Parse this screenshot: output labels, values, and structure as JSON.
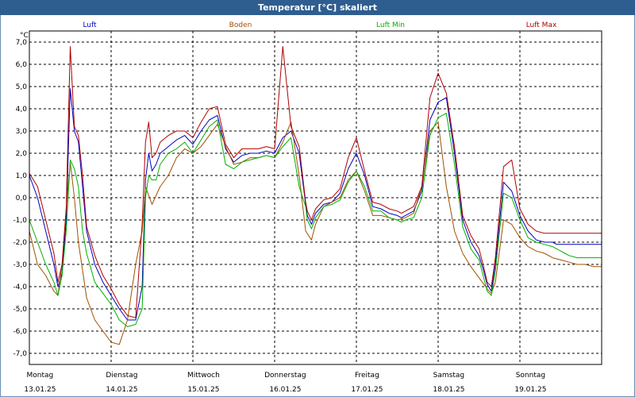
{
  "chart_data": {
    "type": "line",
    "title": "Temperatur [°C] skaliert",
    "ylabel": "°C",
    "ylim": [
      -7.5,
      7.5
    ],
    "yticks": [
      "7,0",
      "6,0",
      "5,0",
      "4,0",
      "3,0",
      "2,0",
      "1,0",
      "0,0",
      "-1,0",
      "-2,0",
      "-3,0",
      "-4,0",
      "-5,0",
      "-6,0",
      "-7,0"
    ],
    "ytick_values": [
      7,
      6,
      5,
      4,
      3,
      2,
      1,
      0,
      -1,
      -2,
      -3,
      -4,
      -5,
      -6,
      -7
    ],
    "xlim": [
      0,
      7
    ],
    "days": [
      {
        "weekday": "Montag",
        "date": "13.01.25"
      },
      {
        "weekday": "Dienstag",
        "date": "14.01.25"
      },
      {
        "weekday": "Mittwoch",
        "date": "15.01.25"
      },
      {
        "weekday": "Donnerstag",
        "date": "16.01.25"
      },
      {
        "weekday": "Freitag",
        "date": "17.01.25"
      },
      {
        "weekday": "Samstag",
        "date": "18.01.25"
      },
      {
        "weekday": "Sonntag",
        "date": "19.01.25"
      }
    ],
    "grid": true,
    "legend_position": "top",
    "series": [
      {
        "name": "Luft",
        "color": "#0000c0",
        "x": [
          0,
          0.1,
          0.2,
          0.3,
          0.35,
          0.4,
          0.45,
          0.5,
          0.55,
          0.6,
          0.65,
          0.7,
          0.8,
          0.9,
          1.0,
          1.1,
          1.2,
          1.3,
          1.38,
          1.42,
          1.46,
          1.5,
          1.55,
          1.6,
          1.7,
          1.8,
          1.9,
          2.0,
          2.1,
          2.2,
          2.3,
          2.4,
          2.5,
          2.6,
          2.7,
          2.8,
          2.9,
          3.0,
          3.1,
          3.2,
          3.3,
          3.38,
          3.4,
          3.45,
          3.5,
          3.6,
          3.7,
          3.8,
          3.9,
          4.0,
          4.1,
          4.2,
          4.3,
          4.4,
          4.5,
          4.55,
          4.6,
          4.7,
          4.8,
          4.9,
          5.0,
          5.1,
          5.2,
          5.3,
          5.4,
          5.5,
          5.55,
          5.6,
          5.65,
          5.7,
          5.8,
          5.9,
          6.0,
          6.1,
          6.2,
          6.3,
          6.4,
          6.45,
          6.5,
          6.55,
          6.6,
          6.7,
          6.8,
          6.9,
          7.0
        ],
        "y": [
          1.0,
          0,
          -1.5,
          -3.0,
          -4.0,
          -3.4,
          -1.0,
          4.9,
          3.0,
          2.5,
          0.5,
          -1.5,
          -3.0,
          -3.8,
          -4.4,
          -5.0,
          -5.5,
          -5.5,
          -4.0,
          0.8,
          2.0,
          1.2,
          1.5,
          2.0,
          2.3,
          2.6,
          2.8,
          2.4,
          3.0,
          3.5,
          3.7,
          2.2,
          1.6,
          1.9,
          2.0,
          2.0,
          2.1,
          2.0,
          2.7,
          3.0,
          2.0,
          -0.3,
          -0.8,
          -1.2,
          -0.7,
          -0.3,
          -0.2,
          0.2,
          1.3,
          2.0,
          1.0,
          -0.4,
          -0.5,
          -0.7,
          -0.8,
          -0.9,
          -0.8,
          -0.6,
          0.3,
          3.5,
          4.3,
          4.5,
          2.0,
          -1.0,
          -2.0,
          -2.6,
          -3.2,
          -3.9,
          -4.2,
          -3.0,
          0.7,
          0.3,
          -0.8,
          -1.5,
          -1.9,
          -2.0,
          -2.0,
          -2.1,
          -2.1,
          -2.1,
          -2.1,
          -2.1,
          -2.1,
          -2.1,
          -2.1
        ]
      },
      {
        "name": "Boden",
        "color": "#a05000",
        "x": [
          0,
          0.1,
          0.2,
          0.3,
          0.35,
          0.4,
          0.45,
          0.5,
          0.55,
          0.6,
          0.7,
          0.8,
          0.9,
          1.0,
          1.1,
          1.2,
          1.3,
          1.38,
          1.42,
          1.5,
          1.6,
          1.7,
          1.8,
          1.9,
          2.0,
          2.1,
          2.2,
          2.3,
          2.4,
          2.5,
          2.6,
          2.7,
          2.8,
          2.9,
          3.0,
          3.1,
          3.2,
          3.3,
          3.38,
          3.45,
          3.5,
          3.6,
          3.7,
          3.8,
          3.9,
          4.0,
          4.1,
          4.2,
          4.3,
          4.4,
          4.5,
          4.6,
          4.7,
          4.8,
          4.9,
          5.0,
          5.1,
          5.2,
          5.3,
          5.4,
          5.5,
          5.6,
          5.65,
          5.7,
          5.8,
          5.9,
          6.0,
          6.1,
          6.2,
          6.3,
          6.4,
          6.5,
          6.6,
          6.7,
          6.8,
          6.9,
          7.0
        ],
        "y": [
          -1.5,
          -3.0,
          -3.5,
          -4.2,
          -4.4,
          -3.0,
          -0.5,
          1.6,
          0,
          -2.0,
          -4.5,
          -5.5,
          -6.0,
          -6.5,
          -6.6,
          -5.5,
          -3.0,
          -1.5,
          0.5,
          -0.3,
          0.5,
          1.0,
          1.8,
          2.2,
          2.0,
          2.3,
          2.8,
          3.3,
          2.3,
          1.5,
          1.6,
          1.8,
          1.8,
          1.9,
          1.8,
          2.5,
          3.4,
          1.0,
          -1.5,
          -1.9,
          -1.2,
          -0.4,
          -0.2,
          0.0,
          0.8,
          1.2,
          0.3,
          -0.8,
          -0.8,
          -0.9,
          -1.0,
          -0.9,
          -0.7,
          0.5,
          3.0,
          3.4,
          0.5,
          -1.5,
          -2.5,
          -3.1,
          -3.6,
          -4.1,
          -4.3,
          -3.8,
          -1.0,
          -1.2,
          -1.8,
          -2.2,
          -2.4,
          -2.5,
          -2.7,
          -2.8,
          -2.9,
          -3.0,
          -3.0,
          -3.1,
          -3.1
        ]
      },
      {
        "name": "Luft Min",
        "color": "#00b000",
        "x": [
          0,
          0.1,
          0.2,
          0.3,
          0.35,
          0.4,
          0.45,
          0.5,
          0.55,
          0.6,
          0.65,
          0.7,
          0.8,
          0.9,
          1.0,
          1.1,
          1.2,
          1.3,
          1.38,
          1.42,
          1.46,
          1.5,
          1.55,
          1.6,
          1.7,
          1.8,
          1.9,
          2.0,
          2.1,
          2.2,
          2.3,
          2.4,
          2.5,
          2.6,
          2.7,
          2.8,
          2.9,
          3.0,
          3.1,
          3.2,
          3.3,
          3.38,
          3.4,
          3.45,
          3.5,
          3.6,
          3.7,
          3.8,
          3.9,
          4.0,
          4.1,
          4.2,
          4.3,
          4.4,
          4.5,
          4.55,
          4.6,
          4.7,
          4.8,
          4.9,
          5.0,
          5.1,
          5.2,
          5.3,
          5.4,
          5.5,
          5.55,
          5.6,
          5.65,
          5.7,
          5.8,
          5.9,
          6.0,
          6.1,
          6.2,
          6.3,
          6.4,
          6.45,
          6.5,
          6.55,
          6.6,
          6.7,
          6.8,
          6.9,
          7.0
        ],
        "y": [
          -1.0,
          -2.0,
          -3.0,
          -3.8,
          -4.4,
          -3.5,
          -1.5,
          1.7,
          1.3,
          0.5,
          -1.5,
          -2.5,
          -3.8,
          -4.3,
          -4.8,
          -5.5,
          -5.8,
          -5.7,
          -5.0,
          0.0,
          1.0,
          0.8,
          0.8,
          1.5,
          2.0,
          2.2,
          2.5,
          2.0,
          2.6,
          3.2,
          3.5,
          1.5,
          1.3,
          1.6,
          1.7,
          1.8,
          1.9,
          1.8,
          2.3,
          2.7,
          0.5,
          -0.4,
          -1.0,
          -1.4,
          -0.9,
          -0.4,
          -0.3,
          -0.1,
          0.7,
          1.2,
          0.5,
          -0.6,
          -0.6,
          -0.9,
          -1.0,
          -1.1,
          -1.0,
          -0.9,
          0.0,
          2.8,
          3.6,
          3.8,
          1.5,
          -1.3,
          -2.3,
          -2.8,
          -3.5,
          -4.2,
          -4.4,
          -3.3,
          0.2,
          0,
          -1.0,
          -1.8,
          -2.0,
          -2.1,
          -2.2,
          -2.3,
          -2.4,
          -2.5,
          -2.6,
          -2.7,
          -2.7,
          -2.7,
          -2.7
        ]
      },
      {
        "name": "Luft Max",
        "color": "#b00000",
        "x": [
          0,
          0.1,
          0.2,
          0.3,
          0.35,
          0.4,
          0.45,
          0.5,
          0.55,
          0.6,
          0.65,
          0.7,
          0.8,
          0.9,
          1.0,
          1.1,
          1.2,
          1.3,
          1.38,
          1.42,
          1.46,
          1.5,
          1.55,
          1.6,
          1.7,
          1.8,
          1.9,
          2.0,
          2.1,
          2.2,
          2.3,
          2.4,
          2.5,
          2.6,
          2.7,
          2.8,
          2.9,
          3.0,
          3.1,
          3.2,
          3.3,
          3.38,
          3.4,
          3.45,
          3.5,
          3.6,
          3.7,
          3.8,
          3.9,
          4.0,
          4.1,
          4.2,
          4.3,
          4.4,
          4.5,
          4.55,
          4.6,
          4.7,
          4.8,
          4.9,
          5.0,
          5.1,
          5.2,
          5.3,
          5.4,
          5.5,
          5.55,
          5.6,
          5.65,
          5.7,
          5.8,
          5.9,
          6.0,
          6.1,
          6.2,
          6.3,
          6.4,
          6.45,
          6.5,
          6.55,
          6.6,
          6.7,
          6.8,
          6.9,
          7.0
        ],
        "y": [
          1.1,
          0.5,
          -1.0,
          -2.5,
          -3.8,
          -3.0,
          -0.5,
          6.8,
          3.2,
          2.8,
          1.0,
          -1.3,
          -2.6,
          -3.5,
          -4.1,
          -4.8,
          -5.3,
          -5.4,
          -1.2,
          2.5,
          3.4,
          1.8,
          2.0,
          2.5,
          2.8,
          3.0,
          3.0,
          2.7,
          3.4,
          4.0,
          4.1,
          2.4,
          1.8,
          2.2,
          2.2,
          2.2,
          2.3,
          2.2,
          6.8,
          3.2,
          2.3,
          -0.2,
          -0.6,
          -1.0,
          -0.5,
          -0.1,
          0.0,
          0.4,
          1.8,
          2.7,
          1.2,
          -0.2,
          -0.3,
          -0.5,
          -0.6,
          -0.7,
          -0.6,
          -0.4,
          0.5,
          4.5,
          5.6,
          4.7,
          2.3,
          -0.8,
          -1.7,
          -2.3,
          -3.0,
          -3.8,
          -4.0,
          -2.7,
          1.4,
          1.7,
          -0.5,
          -1.2,
          -1.5,
          -1.6,
          -1.6,
          -1.6,
          -1.6,
          -1.6,
          -1.6,
          -1.6,
          -1.6,
          -1.6,
          -1.6
        ]
      }
    ]
  }
}
